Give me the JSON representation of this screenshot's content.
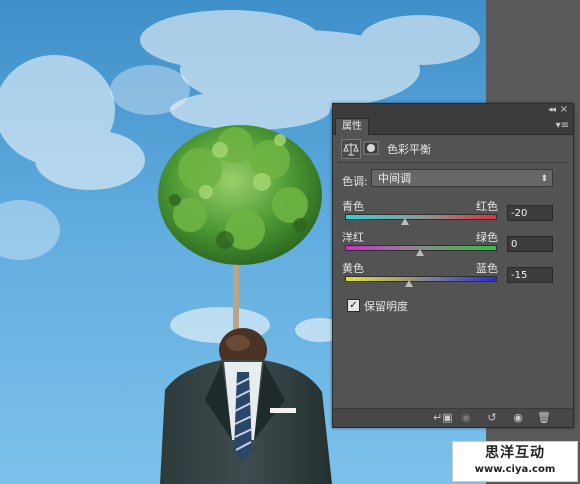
{
  "panel": {
    "tab_label": "属性",
    "adjustment_title": "色彩平衡",
    "tone_label": "色调:",
    "tone_value": "中间调",
    "sliders": [
      {
        "left_label": "青色",
        "right_label": "红色",
        "value": "-20"
      },
      {
        "left_label": "洋红",
        "right_label": "绿色",
        "value": "0"
      },
      {
        "left_label": "黄色",
        "right_label": "蓝色",
        "value": "-15"
      }
    ],
    "preserve_luminosity_label": "保留明度",
    "preserve_luminosity_checked": true
  },
  "icons": {
    "balance": "balance-scale-icon",
    "mask": "layer-mask-icon",
    "collapse": "double-chevron-icon",
    "close": "close-icon",
    "menu": "panel-menu-icon",
    "clip": "clip-to-layer-icon",
    "view_previous": "view-previous-state-icon",
    "reset": "reset-icon",
    "visibility": "eye-icon",
    "delete": "trash-icon"
  },
  "watermark": {
    "title": "思洋互动",
    "url": "www.ciya.com"
  }
}
